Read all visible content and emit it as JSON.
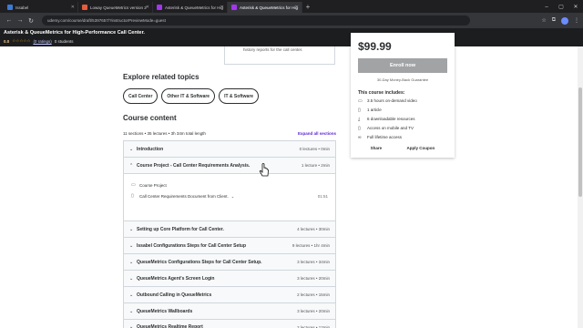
{
  "browser": {
    "tabs": [
      {
        "label": "Issabel",
        "color": "#3a7bd5",
        "active": false
      },
      {
        "label": "Loway QueueMetrics version 2",
        "color": "#e55b3c",
        "active": false
      },
      {
        "label": "Asterisk & QueueMetrics for Hig",
        "color": "#a435f0",
        "active": false
      },
      {
        "label": "Asterisk & QueueMetrics for Hig",
        "color": "#a435f0",
        "active": true
      }
    ],
    "url": "udemy.com/course/draft/5397657/?instructorPreviewMode=guest"
  },
  "course": {
    "title": "Asterisk & QueueMetrics for High-Performance Call Center.",
    "rating": "0.0",
    "ratings_link": "(0 ratings)",
    "students": "0 students"
  },
  "prev_card_text": "history reports for the call center.",
  "related": {
    "heading": "Explore related topics",
    "topics": [
      "Call Center",
      "Other IT & Software",
      "IT & Software"
    ]
  },
  "content": {
    "heading": "Course content",
    "summary": "11 sections • 35 lectures • 3h 34m total length",
    "expand_label": "Expand all sections",
    "sections": [
      {
        "name": "Introduction",
        "count": "0 lectures • 0min",
        "open": false
      },
      {
        "name": "Course Project - Call Center Requirements Analysis.",
        "count": "1 lecture • 2min",
        "open": true
      },
      {
        "name": "Setting up Core Platform for Call Center.",
        "count": "4 lectures • 30min",
        "open": false
      },
      {
        "name": "Issabel Configurations Steps for Call Center Setup",
        "count": "9 lectures • 1hr 4min",
        "open": false
      },
      {
        "name": "QueueMetrics Configurations Steps for Call Center Setup.",
        "count": "3 lectures • 34min",
        "open": false
      },
      {
        "name": "QueueMetrics Agent's Screen Login",
        "count": "3 lectures • 20min",
        "open": false
      },
      {
        "name": "Outbound Calling in QueueMetrics",
        "count": "2 lectures • 15min",
        "open": false
      },
      {
        "name": "QueueMetrics Wallboards",
        "count": "3 lectures • 20min",
        "open": false
      },
      {
        "name": "QueueMetrics Realtime Report",
        "count": "2 lectures • 12min",
        "open": false
      }
    ],
    "open_lectures": [
      {
        "name": "Course Project",
        "duration": ""
      },
      {
        "name": "Call Center Requirements Document from Client.",
        "duration": "01:51"
      }
    ]
  },
  "sidebar": {
    "price": "$99.99",
    "enroll": "Enroll now",
    "guarantee": "30-Day Money-Back Guarantee",
    "includes_title": "This course includes:",
    "includes": [
      {
        "icon": "video-icon",
        "glyph": "▭",
        "text": "3.5 hours on-demand video"
      },
      {
        "icon": "article-icon",
        "glyph": "▯",
        "text": "1 article"
      },
      {
        "icon": "download-icon",
        "glyph": "⤓",
        "text": "6 downloadable resources"
      },
      {
        "icon": "mobile-icon",
        "glyph": "▯",
        "text": "Access on mobile and TV"
      },
      {
        "icon": "infinity-icon",
        "glyph": "∞",
        "text": "Full lifetime access"
      }
    ],
    "share": "Share",
    "coupon": "Apply Coupon"
  }
}
